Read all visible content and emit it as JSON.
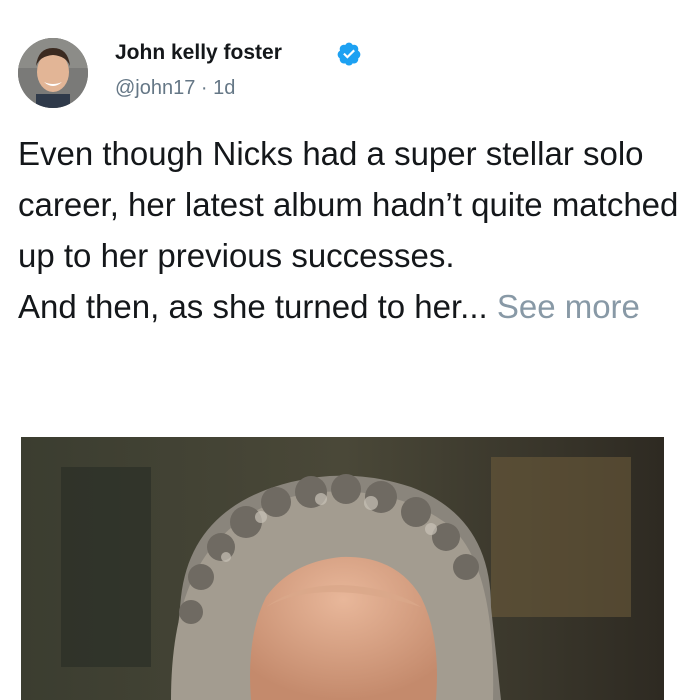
{
  "author": {
    "name": "John kelly foster",
    "handle": "@john17",
    "separator": " · ",
    "time": "1d",
    "verified": true,
    "avatar_icon": "profile-photo"
  },
  "tweet": {
    "paragraph1": "Even though Nicks had a super stellar solo career, her latest album hadn’t quite matched up to her previous successes.",
    "paragraph2": "And then, as she turned to her...",
    "see_more": "See more"
  },
  "colors": {
    "text": "#14171a",
    "secondary": "#657786",
    "see_more": "#8899a6",
    "verified": "#1da1f2"
  },
  "media": {
    "kind": "photo of a man with curly gray hair"
  }
}
